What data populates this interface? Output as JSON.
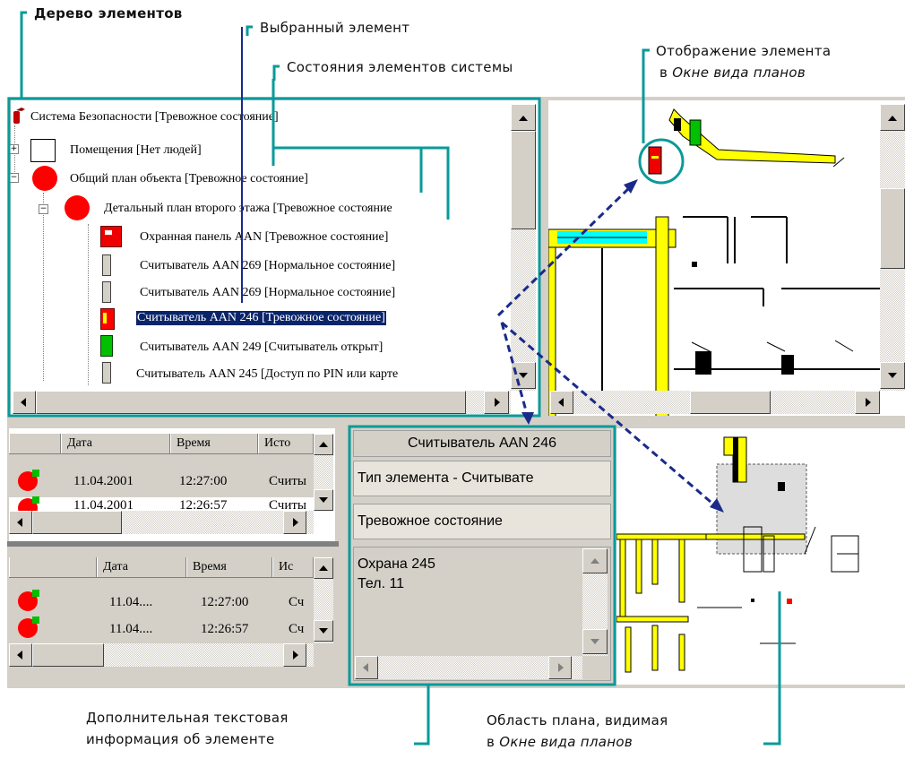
{
  "callouts": {
    "tree": "Дерево элементов",
    "selected": "Выбранный элемент",
    "states": "Состояния элементов системы",
    "display_line1": "Отображение элемента",
    "display_line2_prefix": "в ",
    "display_line2_italic": "Окне вида планов",
    "extra_line1": "Дополнительная текстовая",
    "extra_line2": "информация об элементе",
    "area_line1": "Область плана, видимая",
    "area_line2_prefix": "в ",
    "area_line2_italic": "Окне вида планов"
  },
  "tree": {
    "items": [
      {
        "label": "Система Безопасности [Тревожное состояние]",
        "icon": "fire-extinguisher-icon"
      },
      {
        "label": "Помещения [Нет людей]",
        "icon": "empty-room-icon"
      },
      {
        "label": "Общий план объекта [Тревожное состояние]",
        "icon": "red-circle-icon"
      },
      {
        "label": "Детальный план второго этажа [Тревожное состояние",
        "icon": "red-circle-icon"
      },
      {
        "label": "Охранная панель AAN [Тревожное состояние]",
        "icon": "alarm-panel-icon"
      },
      {
        "label": "Считыватель AAN 269 [Нормальное состояние]",
        "icon": "reader-normal-icon"
      },
      {
        "label": "Считыватель AAN 269 [Нормальное состояние]",
        "icon": "reader-normal-icon"
      },
      {
        "label": "Считыватель AAN 246 [Тревожное состояние]",
        "icon": "reader-alarm-icon"
      },
      {
        "label": "Считыватель AAN 249 [Считыватель открыт]",
        "icon": "reader-open-icon"
      },
      {
        "label": "Считыватель AAN 245 [Доступ по PIN или карте",
        "icon": "reader-normal-icon"
      }
    ],
    "expand_minus": "−",
    "expand_plus": "+"
  },
  "events_top": {
    "headers": [
      "",
      "Дата",
      "Время",
      "Исто"
    ],
    "rows": [
      {
        "date": "11.04.2001",
        "time": "12:27:00",
        "source": "Считы"
      },
      {
        "date": "11.04.2001",
        "time": "12:26:57",
        "source": "Считы"
      }
    ]
  },
  "events_bottom": {
    "headers": [
      "",
      "Дата",
      "Время",
      "Ис"
    ],
    "rows": [
      {
        "date": "11.04....",
        "time": "12:27:00",
        "source": "Сч"
      },
      {
        "date": "11.04....",
        "time": "12:26:57",
        "source": "Сч"
      }
    ]
  },
  "info": {
    "name": "Считыватель AAN 246",
    "type": "Тип элемента - Считывате",
    "state": "Тревожное состояние",
    "text_line1": "Охрана 245",
    "text_line2": "Тел. 11"
  },
  "colors": {
    "accent": "#0a9a9a",
    "arrow": "#1a2a8a",
    "selection": "#0a246a",
    "wall": "#ffff00",
    "alarm": "#ff0000",
    "ok": "#00c000"
  }
}
